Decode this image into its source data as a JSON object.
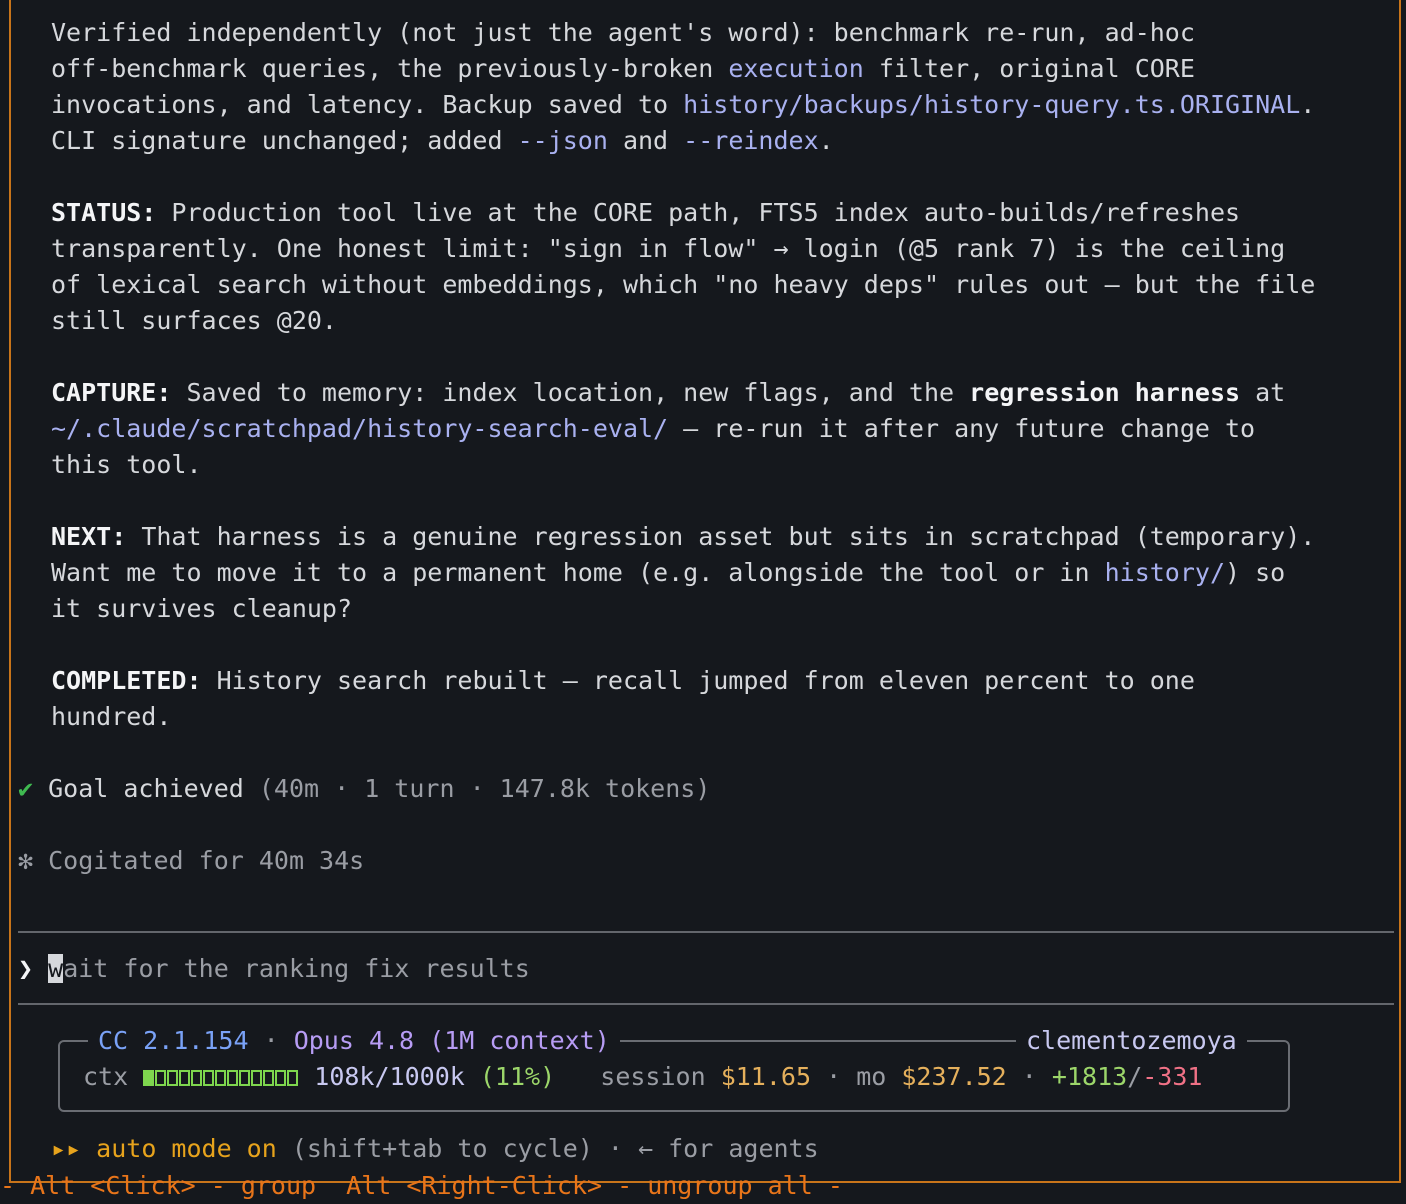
{
  "summary": {
    "line1": "Verified independently (not just the agent's word): benchmark re-run, ad-hoc",
    "line2_a": "off-benchmark queries, the previously-broken ",
    "line2_link": "execution",
    "line2_b": " filter, original CORE",
    "line3_a": "invocations, and latency. Backup saved to ",
    "line3_link": "history/backups/history-query.ts.ORIGINAL",
    "line3_b": ".",
    "line4_a": "CLI signature unchanged; added ",
    "line4_link1": "--json",
    "line4_b": " and ",
    "line4_link2": "--reindex",
    "line4_c": "."
  },
  "status": {
    "label": "STATUS:",
    "line1": " Production tool live at the CORE path, FTS5 index auto-builds/refreshes",
    "line2": "transparently. One honest limit: \"sign in flow\" → login (@5 rank 7) is the ceiling",
    "line3": "of lexical search without embeddings, which \"no heavy deps\" rules out — but the file",
    "line4": "still surfaces @20."
  },
  "capture": {
    "label": "CAPTURE:",
    "line1_a": " Saved to memory: index location, new flags, and the ",
    "line1_bold": "regression harness",
    "line1_b": " at",
    "line2_link": "~/.claude/scratchpad/history-search-eval/",
    "line2_b": " — re-run it after any future change to",
    "line3": "this tool."
  },
  "next": {
    "label": "NEXT:",
    "line1": " That harness is a genuine regression asset but sits in scratchpad (temporary).",
    "line2_a": "Want me to move it to a permanent home (e.g. alongside the tool or in ",
    "line2_link": "history/",
    "line2_b": ") so",
    "line3": "it survives cleanup?"
  },
  "completed": {
    "label": "COMPLETED:",
    "line1": " History search rebuilt — recall jumped from eleven percent to one",
    "line2": "hundred."
  },
  "goal": {
    "check": "✔",
    "text": "Goal achieved",
    "meta": " (40m · 1 turn · 147.8k tokens)"
  },
  "cogitated": {
    "icon": "✻",
    "text": "Cogitated for 40m 34s"
  },
  "prompt": {
    "chevron": "❯",
    "cursor_char": "w",
    "placeholder_rest": "ait for the ranking fix results"
  },
  "statusbox": {
    "cc": "CC 2.1.154",
    "sep": "·",
    "model": "Opus 4.8 (1M context)",
    "user": "clementozemoya",
    "ctx_label": "ctx",
    "ctx_fill_fraction": 0.11,
    "ctx_value": "108k/1000k",
    "ctx_pct": "(11%)",
    "session_label": "session",
    "session_cost": "$11.65",
    "mo_label": "mo",
    "mo_cost": "$237.52",
    "added": "+1813",
    "slash": "/",
    "removed": "-331"
  },
  "mode": {
    "arrows": "▸▸",
    "text": "auto mode on",
    "hint": " (shift+tab to cycle) · ← for agents"
  },
  "bottom_hint": "- Alt <Click> - group  Alt <Right-Click> - ungroup all -",
  "colors": {
    "accent": "#c8741a",
    "link": "#a9b1f0",
    "check": "#3fb950",
    "gold": "#e5b05c"
  }
}
